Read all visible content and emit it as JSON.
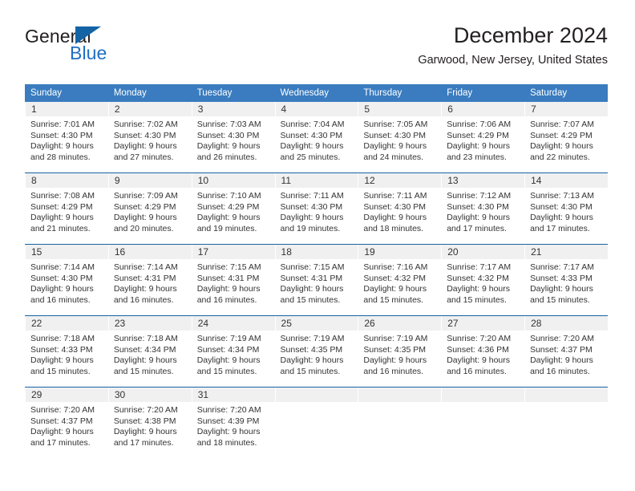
{
  "brand": {
    "name_part1": "General",
    "name_part2": "Blue",
    "accent_color": "#1464a5",
    "text_color": "#231f20"
  },
  "header": {
    "title": "December 2024",
    "subtitle": "Garwood, New Jersey, United States"
  },
  "theme": {
    "header_row_color": "#3a7cbf",
    "row_divider_color": "#1464a5",
    "daynum_band_color": "#f0f0f0"
  },
  "weekdays": [
    "Sunday",
    "Monday",
    "Tuesday",
    "Wednesday",
    "Thursday",
    "Friday",
    "Saturday"
  ],
  "weeks": [
    [
      {
        "day": "1",
        "sunrise": "Sunrise: 7:01 AM",
        "sunset": "Sunset: 4:30 PM",
        "daylight1": "Daylight: 9 hours",
        "daylight2": "and 28 minutes."
      },
      {
        "day": "2",
        "sunrise": "Sunrise: 7:02 AM",
        "sunset": "Sunset: 4:30 PM",
        "daylight1": "Daylight: 9 hours",
        "daylight2": "and 27 minutes."
      },
      {
        "day": "3",
        "sunrise": "Sunrise: 7:03 AM",
        "sunset": "Sunset: 4:30 PM",
        "daylight1": "Daylight: 9 hours",
        "daylight2": "and 26 minutes."
      },
      {
        "day": "4",
        "sunrise": "Sunrise: 7:04 AM",
        "sunset": "Sunset: 4:30 PM",
        "daylight1": "Daylight: 9 hours",
        "daylight2": "and 25 minutes."
      },
      {
        "day": "5",
        "sunrise": "Sunrise: 7:05 AM",
        "sunset": "Sunset: 4:30 PM",
        "daylight1": "Daylight: 9 hours",
        "daylight2": "and 24 minutes."
      },
      {
        "day": "6",
        "sunrise": "Sunrise: 7:06 AM",
        "sunset": "Sunset: 4:29 PM",
        "daylight1": "Daylight: 9 hours",
        "daylight2": "and 23 minutes."
      },
      {
        "day": "7",
        "sunrise": "Sunrise: 7:07 AM",
        "sunset": "Sunset: 4:29 PM",
        "daylight1": "Daylight: 9 hours",
        "daylight2": "and 22 minutes."
      }
    ],
    [
      {
        "day": "8",
        "sunrise": "Sunrise: 7:08 AM",
        "sunset": "Sunset: 4:29 PM",
        "daylight1": "Daylight: 9 hours",
        "daylight2": "and 21 minutes."
      },
      {
        "day": "9",
        "sunrise": "Sunrise: 7:09 AM",
        "sunset": "Sunset: 4:29 PM",
        "daylight1": "Daylight: 9 hours",
        "daylight2": "and 20 minutes."
      },
      {
        "day": "10",
        "sunrise": "Sunrise: 7:10 AM",
        "sunset": "Sunset: 4:29 PM",
        "daylight1": "Daylight: 9 hours",
        "daylight2": "and 19 minutes."
      },
      {
        "day": "11",
        "sunrise": "Sunrise: 7:11 AM",
        "sunset": "Sunset: 4:30 PM",
        "daylight1": "Daylight: 9 hours",
        "daylight2": "and 19 minutes."
      },
      {
        "day": "12",
        "sunrise": "Sunrise: 7:11 AM",
        "sunset": "Sunset: 4:30 PM",
        "daylight1": "Daylight: 9 hours",
        "daylight2": "and 18 minutes."
      },
      {
        "day": "13",
        "sunrise": "Sunrise: 7:12 AM",
        "sunset": "Sunset: 4:30 PM",
        "daylight1": "Daylight: 9 hours",
        "daylight2": "and 17 minutes."
      },
      {
        "day": "14",
        "sunrise": "Sunrise: 7:13 AM",
        "sunset": "Sunset: 4:30 PM",
        "daylight1": "Daylight: 9 hours",
        "daylight2": "and 17 minutes."
      }
    ],
    [
      {
        "day": "15",
        "sunrise": "Sunrise: 7:14 AM",
        "sunset": "Sunset: 4:30 PM",
        "daylight1": "Daylight: 9 hours",
        "daylight2": "and 16 minutes."
      },
      {
        "day": "16",
        "sunrise": "Sunrise: 7:14 AM",
        "sunset": "Sunset: 4:31 PM",
        "daylight1": "Daylight: 9 hours",
        "daylight2": "and 16 minutes."
      },
      {
        "day": "17",
        "sunrise": "Sunrise: 7:15 AM",
        "sunset": "Sunset: 4:31 PM",
        "daylight1": "Daylight: 9 hours",
        "daylight2": "and 16 minutes."
      },
      {
        "day": "18",
        "sunrise": "Sunrise: 7:15 AM",
        "sunset": "Sunset: 4:31 PM",
        "daylight1": "Daylight: 9 hours",
        "daylight2": "and 15 minutes."
      },
      {
        "day": "19",
        "sunrise": "Sunrise: 7:16 AM",
        "sunset": "Sunset: 4:32 PM",
        "daylight1": "Daylight: 9 hours",
        "daylight2": "and 15 minutes."
      },
      {
        "day": "20",
        "sunrise": "Sunrise: 7:17 AM",
        "sunset": "Sunset: 4:32 PM",
        "daylight1": "Daylight: 9 hours",
        "daylight2": "and 15 minutes."
      },
      {
        "day": "21",
        "sunrise": "Sunrise: 7:17 AM",
        "sunset": "Sunset: 4:33 PM",
        "daylight1": "Daylight: 9 hours",
        "daylight2": "and 15 minutes."
      }
    ],
    [
      {
        "day": "22",
        "sunrise": "Sunrise: 7:18 AM",
        "sunset": "Sunset: 4:33 PM",
        "daylight1": "Daylight: 9 hours",
        "daylight2": "and 15 minutes."
      },
      {
        "day": "23",
        "sunrise": "Sunrise: 7:18 AM",
        "sunset": "Sunset: 4:34 PM",
        "daylight1": "Daylight: 9 hours",
        "daylight2": "and 15 minutes."
      },
      {
        "day": "24",
        "sunrise": "Sunrise: 7:19 AM",
        "sunset": "Sunset: 4:34 PM",
        "daylight1": "Daylight: 9 hours",
        "daylight2": "and 15 minutes."
      },
      {
        "day": "25",
        "sunrise": "Sunrise: 7:19 AM",
        "sunset": "Sunset: 4:35 PM",
        "daylight1": "Daylight: 9 hours",
        "daylight2": "and 15 minutes."
      },
      {
        "day": "26",
        "sunrise": "Sunrise: 7:19 AM",
        "sunset": "Sunset: 4:35 PM",
        "daylight1": "Daylight: 9 hours",
        "daylight2": "and 16 minutes."
      },
      {
        "day": "27",
        "sunrise": "Sunrise: 7:20 AM",
        "sunset": "Sunset: 4:36 PM",
        "daylight1": "Daylight: 9 hours",
        "daylight2": "and 16 minutes."
      },
      {
        "day": "28",
        "sunrise": "Sunrise: 7:20 AM",
        "sunset": "Sunset: 4:37 PM",
        "daylight1": "Daylight: 9 hours",
        "daylight2": "and 16 minutes."
      }
    ],
    [
      {
        "day": "29",
        "sunrise": "Sunrise: 7:20 AM",
        "sunset": "Sunset: 4:37 PM",
        "daylight1": "Daylight: 9 hours",
        "daylight2": "and 17 minutes."
      },
      {
        "day": "30",
        "sunrise": "Sunrise: 7:20 AM",
        "sunset": "Sunset: 4:38 PM",
        "daylight1": "Daylight: 9 hours",
        "daylight2": "and 17 minutes."
      },
      {
        "day": "31",
        "sunrise": "Sunrise: 7:20 AM",
        "sunset": "Sunset: 4:39 PM",
        "daylight1": "Daylight: 9 hours",
        "daylight2": "and 18 minutes."
      },
      {
        "day": "",
        "sunrise": "",
        "sunset": "",
        "daylight1": "",
        "daylight2": ""
      },
      {
        "day": "",
        "sunrise": "",
        "sunset": "",
        "daylight1": "",
        "daylight2": ""
      },
      {
        "day": "",
        "sunrise": "",
        "sunset": "",
        "daylight1": "",
        "daylight2": ""
      },
      {
        "day": "",
        "sunrise": "",
        "sunset": "",
        "daylight1": "",
        "daylight2": ""
      }
    ]
  ]
}
